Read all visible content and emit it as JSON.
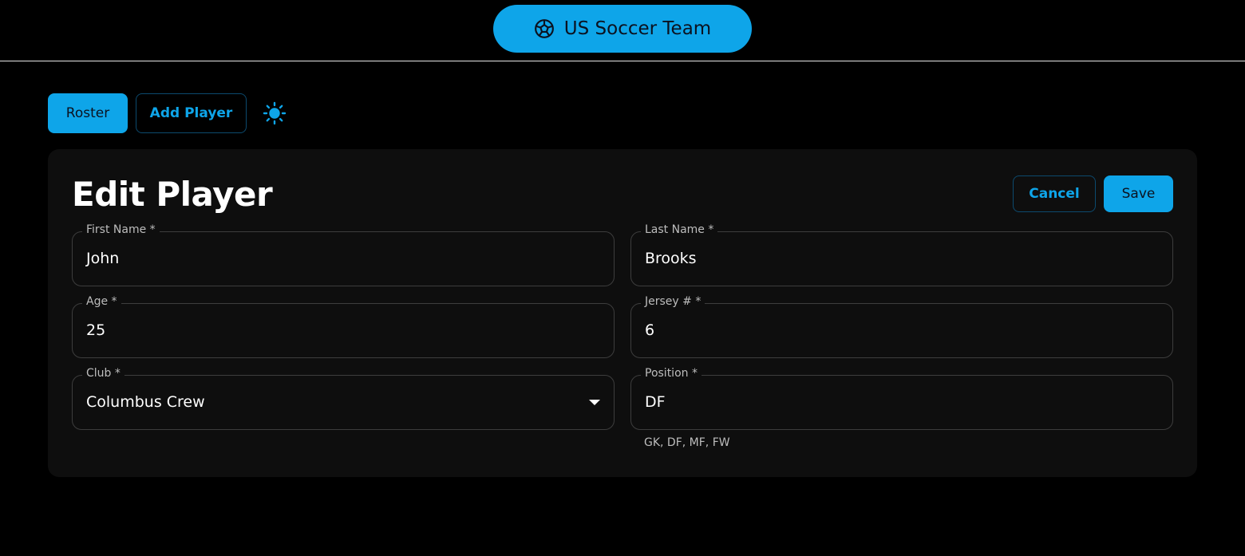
{
  "header": {
    "brand_title": "US Soccer Team",
    "brand_icon": "soccer-ball-icon",
    "accent_color": "#0ea5e9"
  },
  "nav": {
    "roster_label": "Roster",
    "add_player_label": "Add Player",
    "theme_icon": "sun-icon"
  },
  "form": {
    "title": "Edit Player",
    "cancel_label": "Cancel",
    "save_label": "Save",
    "fields": {
      "first_name": {
        "label": "First Name *",
        "value": "John"
      },
      "last_name": {
        "label": "Last Name *",
        "value": "Brooks"
      },
      "age": {
        "label": "Age *",
        "value": "25"
      },
      "jersey": {
        "label": "Jersey # *",
        "value": "6"
      },
      "club": {
        "label": "Club *",
        "value": "Columbus Crew"
      },
      "position": {
        "label": "Position *",
        "value": "DF",
        "helper": "GK, DF, MF, FW"
      }
    }
  }
}
